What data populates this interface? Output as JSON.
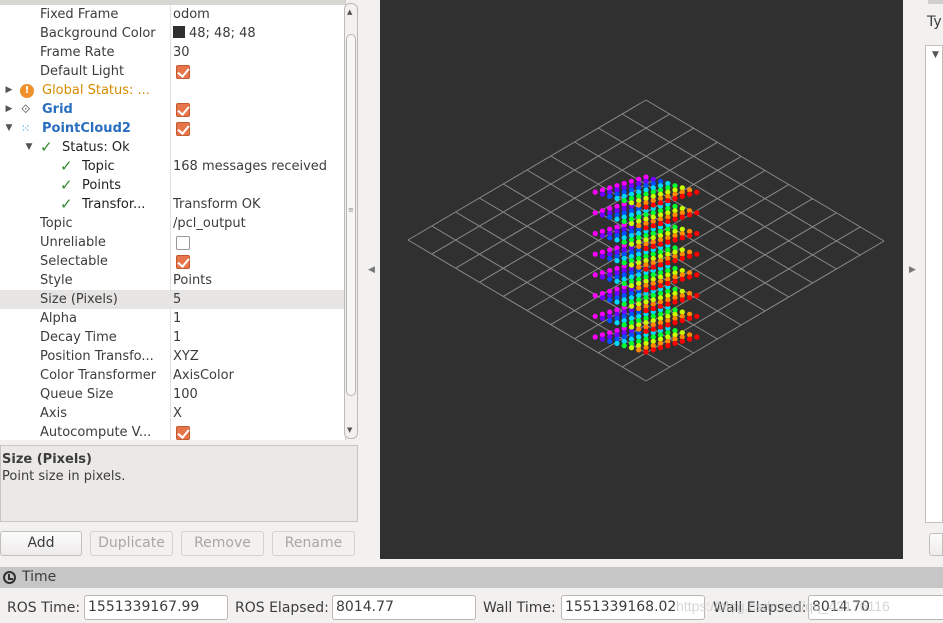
{
  "displays": {
    "rows": [
      {
        "key": "Fixed Frame",
        "value": "odom"
      },
      {
        "key": "Background Color",
        "value": "48; 48; 48",
        "swatch": "#303030"
      },
      {
        "key": "Frame Rate",
        "value": "30"
      },
      {
        "key": "Default Light",
        "checked": true
      },
      {
        "key": "Global Status: ...",
        "status": "warning"
      },
      {
        "key": "Grid",
        "checked": true
      },
      {
        "key": "PointCloud2",
        "checked": true
      },
      {
        "key": "Status: Ok"
      },
      {
        "key": "Topic",
        "value": "168 messages received"
      },
      {
        "key": "Points",
        "value": ""
      },
      {
        "key": "Transfor...",
        "value": "Transform OK"
      },
      {
        "key": "Topic",
        "value": "/pcl_output"
      },
      {
        "key": "Unreliable",
        "checked": false
      },
      {
        "key": "Selectable",
        "checked": true
      },
      {
        "key": "Style",
        "value": "Points"
      },
      {
        "key": "Size (Pixels)",
        "value": "5",
        "selected": true
      },
      {
        "key": "Alpha",
        "value": "1"
      },
      {
        "key": "Decay Time",
        "value": "1"
      },
      {
        "key": "Position Transfo...",
        "value": "XYZ"
      },
      {
        "key": "Color Transformer",
        "value": "AxisColor"
      },
      {
        "key": "Queue Size",
        "value": "100"
      },
      {
        "key": "Axis",
        "value": "X"
      },
      {
        "key": "Autocompute V...",
        "checked": true
      }
    ]
  },
  "description": {
    "title": "Size (Pixels)",
    "text": "Point size in pixels."
  },
  "buttons": {
    "add": "Add",
    "duplicate": "Duplicate",
    "remove": "Remove",
    "rename": "Rename"
  },
  "right_panel": {
    "label": "Ty"
  },
  "time": {
    "title": "Time",
    "ros_time_label": "ROS Time:",
    "ros_time": "1551339167.99",
    "ros_elapsed_label": "ROS Elapsed:",
    "ros_elapsed": "8014.77",
    "wall_time_label": "Wall Time:",
    "wall_time": "1551339168.02",
    "wall_elapsed_label": "Wall Elapsed:",
    "wall_elapsed": "8014.70",
    "watermark": "https://blog.csdn.net/qq_43176116"
  },
  "viewport": {
    "background": "#303030",
    "grid_color": "#8a8a8a",
    "grid_cells": 10,
    "point_cloud": {
      "grid_size": 8,
      "color_transformer": "AxisColor",
      "axis": "X",
      "palette": [
        "#ff0000",
        "#ff8c00",
        "#c8ff00",
        "#00ff30",
        "#00d8ff",
        "#0050ff",
        "#7000ff",
        "#ff00ff"
      ]
    }
  }
}
